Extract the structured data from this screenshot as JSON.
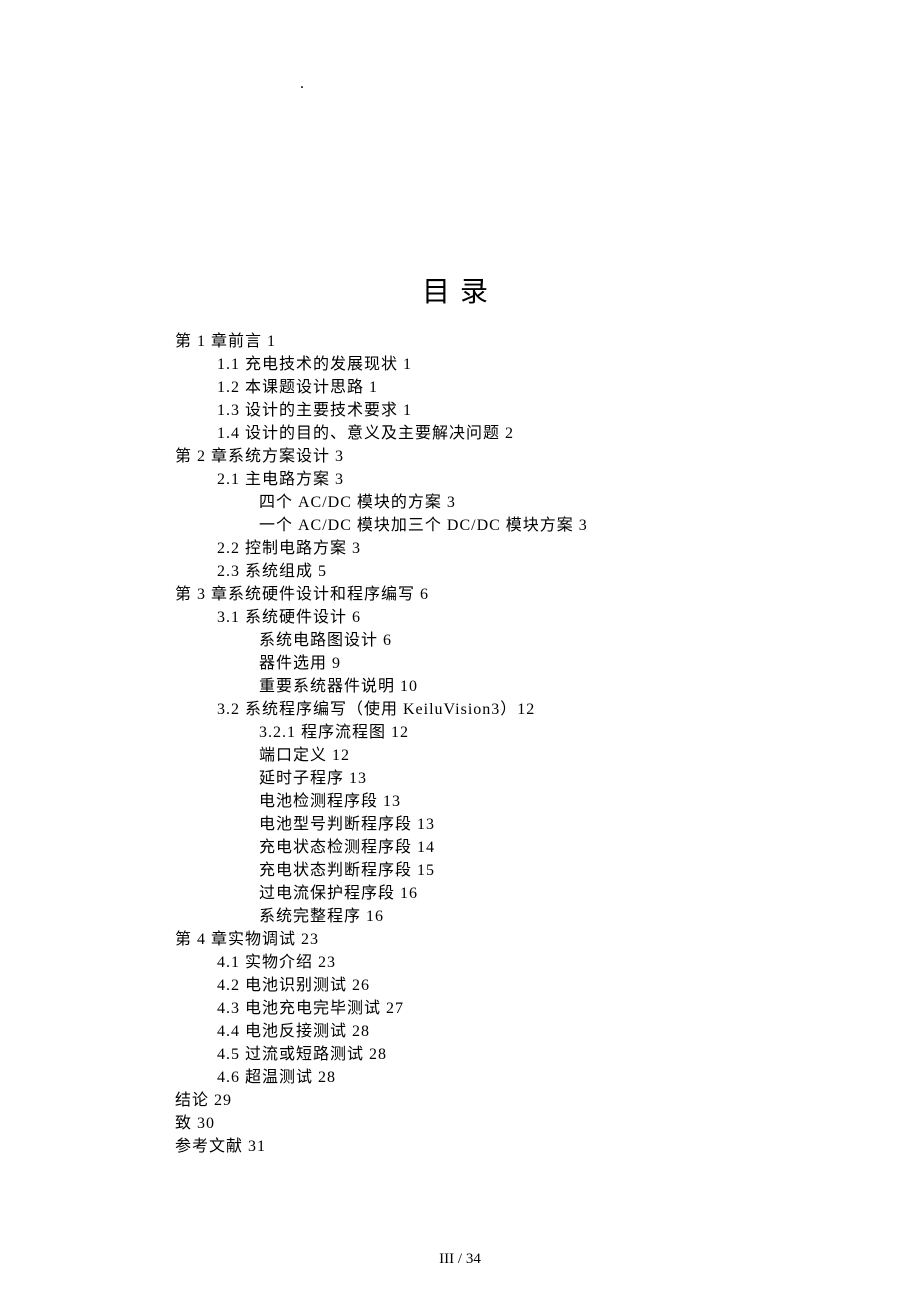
{
  "dot": ".",
  "title": "目录",
  "toc": [
    {
      "level": 0,
      "text": "第 1 章前言 1"
    },
    {
      "level": 1,
      "text": "1.1 充电技术的发展现状 1"
    },
    {
      "level": 1,
      "text": "1.2 本课题设计思路 1"
    },
    {
      "level": 1,
      "text": "1.3 设计的主要技术要求 1"
    },
    {
      "level": 1,
      "text": "1.4 设计的目的、意义及主要解决问题 2"
    },
    {
      "level": 0,
      "text": "第 2 章系统方案设计 3"
    },
    {
      "level": 1,
      "text": "2.1 主电路方案 3"
    },
    {
      "level": 2,
      "text": "四个 AC/DC 模块的方案 3"
    },
    {
      "level": 2,
      "text": "一个 AC/DC 模块加三个 DC/DC 模块方案 3"
    },
    {
      "level": 1,
      "text": "2.2 控制电路方案 3"
    },
    {
      "level": 1,
      "text": "2.3 系统组成 5"
    },
    {
      "level": 0,
      "text": "第 3 章系统硬件设计和程序编写 6"
    },
    {
      "level": 1,
      "text": "3.1 系统硬件设计 6"
    },
    {
      "level": 2,
      "text": "系统电路图设计 6"
    },
    {
      "level": 2,
      "text": "器件选用 9"
    },
    {
      "level": 2,
      "text": "重要系统器件说明 10"
    },
    {
      "level": 1,
      "text": "3.2 系统程序编写（使用 KeiluVision3）12"
    },
    {
      "level": 2,
      "text": "3.2.1 程序流程图 12"
    },
    {
      "level": 2,
      "text": "端口定义 12"
    },
    {
      "level": 2,
      "text": "延时子程序 13"
    },
    {
      "level": 2,
      "text": "电池检测程序段 13"
    },
    {
      "level": 2,
      "text": "电池型号判断程序段 13"
    },
    {
      "level": 2,
      "text": "充电状态检测程序段 14"
    },
    {
      "level": 2,
      "text": "充电状态判断程序段 15"
    },
    {
      "level": 2,
      "text": "过电流保护程序段 16"
    },
    {
      "level": 2,
      "text": "系统完整程序 16"
    },
    {
      "level": 0,
      "text": "第 4 章实物调试 23"
    },
    {
      "level": 1,
      "text": "4.1 实物介绍 23"
    },
    {
      "level": 1,
      "text": "4.2 电池识别测试 26"
    },
    {
      "level": 1,
      "text": "4.3 电池充电完毕测试 27"
    },
    {
      "level": 1,
      "text": "4.4 电池反接测试 28"
    },
    {
      "level": 1,
      "text": "4.5 过流或短路测试 28"
    },
    {
      "level": 1,
      "text": "4.6 超温测试 28"
    },
    {
      "level": 0,
      "text": "结论 29"
    },
    {
      "level": 0,
      "text": "致 30"
    },
    {
      "level": 0,
      "text": "参考文献 31"
    }
  ],
  "footer": "III / 34"
}
